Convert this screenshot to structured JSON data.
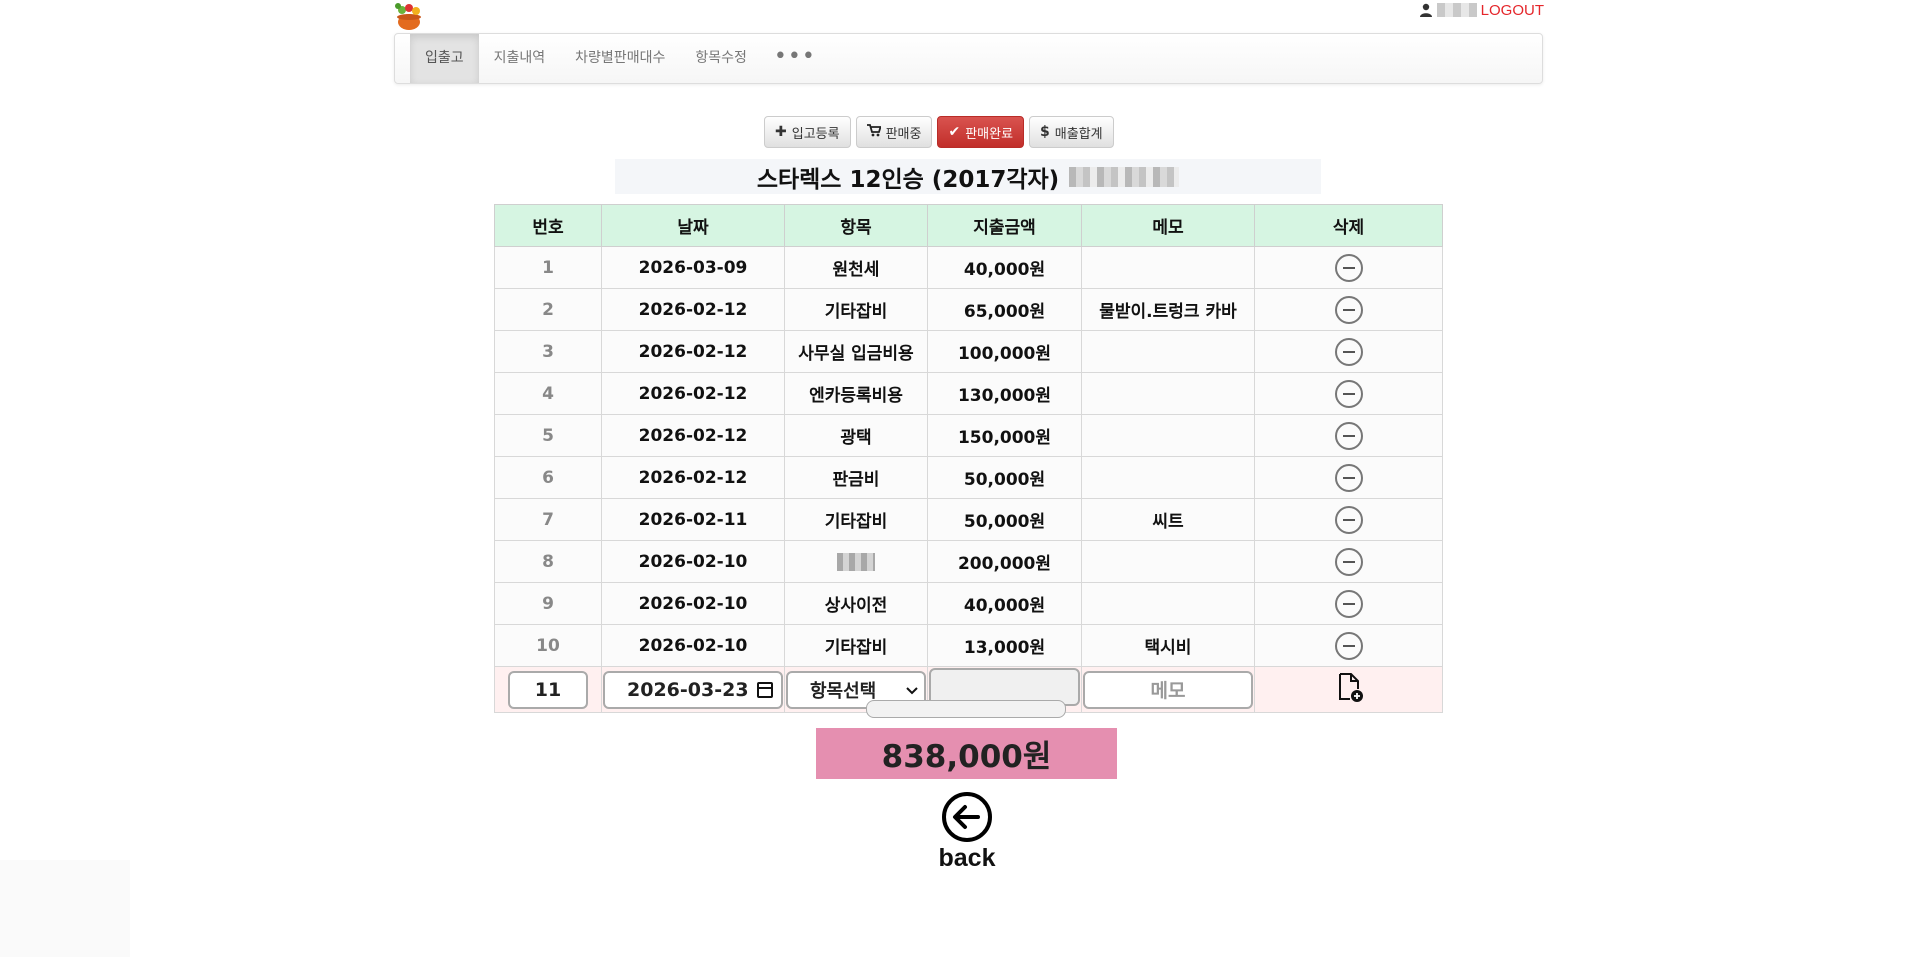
{
  "header": {
    "logo_icon": "vegetable-basket-logo",
    "user_icon": "user-icon",
    "logout_label": "LOGOUT"
  },
  "nav": {
    "tabs": [
      {
        "label": "입출고",
        "active": true
      },
      {
        "label": "지출내역",
        "active": false
      },
      {
        "label": "차량별판매대수",
        "active": false
      },
      {
        "label": "항목수정",
        "active": false
      }
    ],
    "more_label": "•••"
  },
  "actions": {
    "register": {
      "icon": "plus-icon",
      "label": "입고등록"
    },
    "selling": {
      "icon": "cart-icon",
      "label": "판매중"
    },
    "sold": {
      "icon": "check-icon",
      "label": "판매완료"
    },
    "sales_total": {
      "icon": "dollar-icon",
      "label": "매출합계"
    }
  },
  "vehicle": {
    "title": "스타렉스 12인승 (2017각자)"
  },
  "table": {
    "headers": [
      "번호",
      "날짜",
      "항목",
      "지출금액",
      "메모",
      "삭제"
    ],
    "rows": [
      {
        "no": "1",
        "date": "2026-03-09",
        "item": "원천세",
        "amount": "40,000원",
        "memo": ""
      },
      {
        "no": "2",
        "date": "2026-02-12",
        "item": "기타잡비",
        "amount": "65,000원",
        "memo": "물받이.트렁크 카바"
      },
      {
        "no": "3",
        "date": "2026-02-12",
        "item": "사무실 입금비용",
        "amount": "100,000원",
        "memo": ""
      },
      {
        "no": "4",
        "date": "2026-02-12",
        "item": "엔카등록비용",
        "amount": "130,000원",
        "memo": ""
      },
      {
        "no": "5",
        "date": "2026-02-12",
        "item": "광택",
        "amount": "150,000원",
        "memo": ""
      },
      {
        "no": "6",
        "date": "2026-02-12",
        "item": "판금비",
        "amount": "50,000원",
        "memo": ""
      },
      {
        "no": "7",
        "date": "2026-02-11",
        "item": "기타잡비",
        "amount": "50,000원",
        "memo": "씨트"
      },
      {
        "no": "8",
        "date": "2026-02-10",
        "item": "",
        "amount": "200,000원",
        "memo": ""
      },
      {
        "no": "9",
        "date": "2026-02-10",
        "item": "상사이전",
        "amount": "40,000원",
        "memo": ""
      },
      {
        "no": "10",
        "date": "2026-02-10",
        "item": "기타잡비",
        "amount": "13,000원",
        "memo": "택시비"
      }
    ],
    "new_row": {
      "no": "11",
      "date": "2026-03-23",
      "item_placeholder": "항목선택",
      "amount": "",
      "memo_placeholder": "메모"
    }
  },
  "progress": {
    "value": 0
  },
  "total": {
    "amount": "838,000원"
  },
  "back": {
    "icon": "arrow-left-circle-icon",
    "label": "back"
  }
}
